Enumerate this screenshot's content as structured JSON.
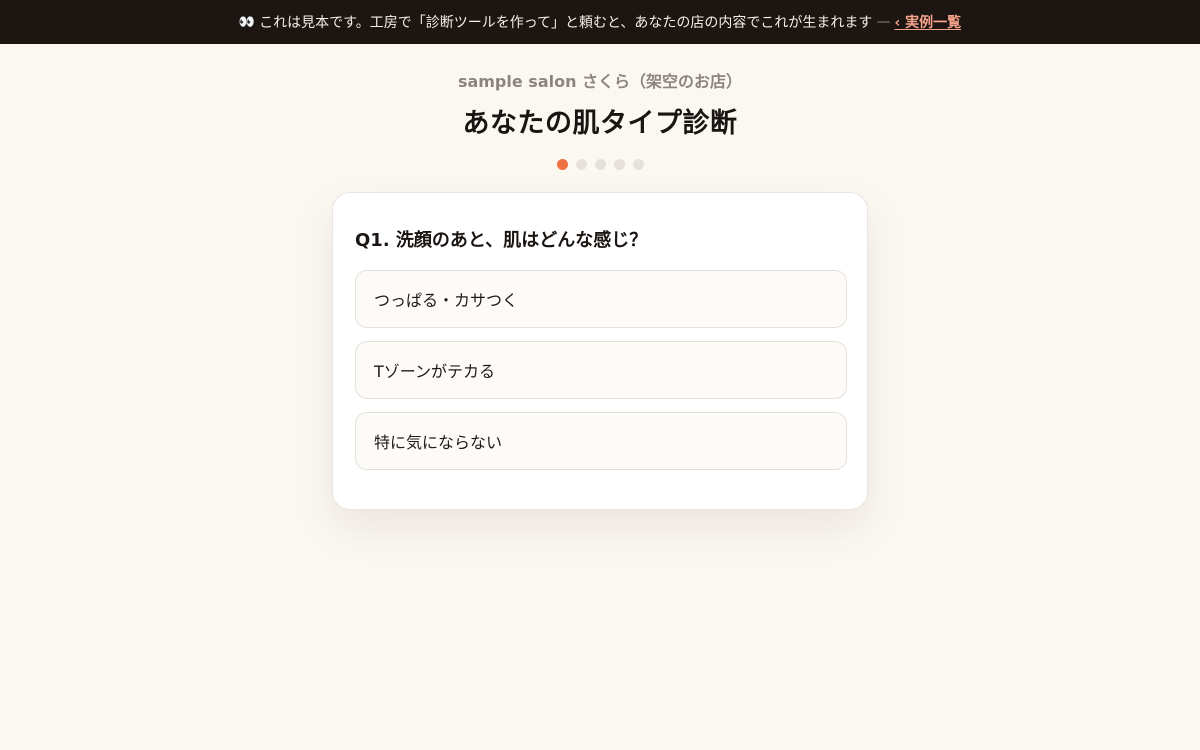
{
  "banner": {
    "eyes_icon": "👀",
    "text": "これは見本です。工房で「診断ツールを作って」と頼むと、あなたの店の内容でこれが生まれます",
    "dash": "—",
    "back_link": "‹ 実例一覧",
    "link_color": "#f6a48a"
  },
  "header": {
    "shop_name": "sample salon さくら（架空のお店）",
    "title": "あなたの肌タイプ診断"
  },
  "progress": {
    "current": 1,
    "total": 5,
    "active_color": "#ef7043"
  },
  "question": {
    "text": "Q1. 洗顔のあと、肌はどんな感じ？",
    "options": [
      "つっぱる・カサつく",
      "Tゾーンがテカる",
      "特に気にならない"
    ]
  }
}
